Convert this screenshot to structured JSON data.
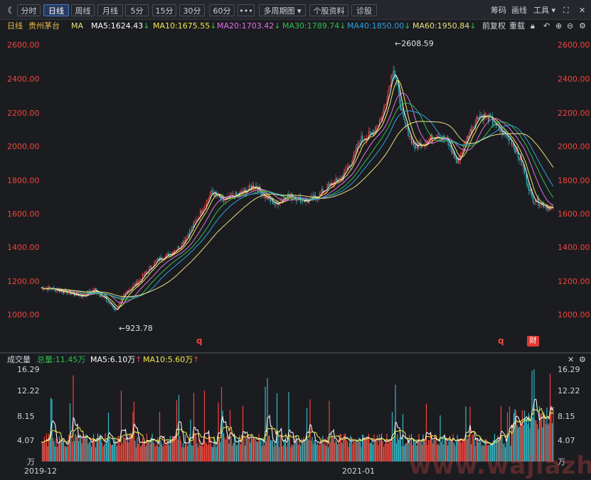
{
  "toolbar": {
    "back_label": "《",
    "tabs": [
      "分时",
      "日线",
      "周线",
      "月线",
      "5分",
      "15分",
      "30分",
      "60分",
      "•••",
      "多周期图 ▾",
      "个股资料",
      "诊股"
    ],
    "active_tab": "日线",
    "right": [
      "筹码",
      "画线",
      "工具 ▾"
    ]
  },
  "info": {
    "period": "日线",
    "stock_name": "贵州茅台",
    "ma_label": "MA",
    "ma5": "MA5:1624.43",
    "ma10": "MA10:1675.55",
    "ma20": "MA20:1703.42",
    "ma30": "MA30:1789.74",
    "ma40": "MA40:1850.00",
    "ma60": "MA60:1950.84",
    "down_arrow": "↓",
    "fuquan": "前复权",
    "reload": "重载"
  },
  "colors": {
    "ma5": "#ffffff",
    "ma10": "#f2e94a",
    "ma20": "#e070e8",
    "ma30": "#2fbf4f",
    "ma40": "#2fa0e0",
    "ma60": "#e8e07a",
    "up": "#f0443a",
    "down": "#31b8c6"
  },
  "price_axis": [
    "2600.00",
    "2400.00",
    "2200.00",
    "2000.00",
    "1800.00",
    "1600.00",
    "1400.00",
    "1200.00",
    "1000.00"
  ],
  "annotations": {
    "high": "2608.59",
    "low": "923.78",
    "high_arrow": "←",
    "low_arrow": "←"
  },
  "q_marks": [
    "q",
    "q"
  ],
  "cai_badge": "财",
  "volume": {
    "title": "成交量",
    "total": "总量:11.45万",
    "ma5": "MA5:6.10万",
    "ma10": "MA10:5.60万",
    "up_arrow": "↑",
    "axis": [
      "16.29",
      "12.22",
      "8.15",
      "4.07",
      "万"
    ]
  },
  "dates": [
    "2019-12",
    "2021-01"
  ],
  "watermark": "www.wajiazhi.com",
  "chart_data": {
    "type": "candlestick",
    "title": "贵州茅台 日线",
    "ylim": [
      900,
      2650
    ],
    "max_label": 2608.59,
    "min_label": 923.78,
    "close_path_approx": [
      [
        0,
        1120
      ],
      [
        10,
        1115
      ],
      [
        20,
        1100
      ],
      [
        30,
        1080
      ],
      [
        40,
        1070
      ],
      [
        50,
        1110
      ],
      [
        60,
        1050
      ],
      [
        70,
        980
      ],
      [
        80,
        1100
      ],
      [
        90,
        1150
      ],
      [
        100,
        1230
      ],
      [
        110,
        1300
      ],
      [
        120,
        1330
      ],
      [
        130,
        1380
      ],
      [
        140,
        1480
      ],
      [
        150,
        1600
      ],
      [
        160,
        1720
      ],
      [
        170,
        1660
      ],
      [
        180,
        1690
      ],
      [
        190,
        1720
      ],
      [
        200,
        1760
      ],
      [
        210,
        1690
      ],
      [
        220,
        1640
      ],
      [
        230,
        1700
      ],
      [
        240,
        1680
      ],
      [
        250,
        1660
      ],
      [
        260,
        1700
      ],
      [
        270,
        1760
      ],
      [
        280,
        1800
      ],
      [
        290,
        1900
      ],
      [
        300,
        2050
      ],
      [
        310,
        2080
      ],
      [
        320,
        2200
      ],
      [
        330,
        2500
      ],
      [
        340,
        2150
      ],
      [
        350,
        2000
      ],
      [
        360,
        2030
      ],
      [
        370,
        2080
      ],
      [
        380,
        2040
      ],
      [
        390,
        1900
      ],
      [
        400,
        2070
      ],
      [
        410,
        2200
      ],
      [
        420,
        2180
      ],
      [
        430,
        2100
      ],
      [
        440,
        2050
      ],
      [
        450,
        1900
      ],
      [
        460,
        1680
      ],
      [
        470,
        1640
      ],
      [
        480,
        1610
      ]
    ],
    "volume_ylim": [
      0,
      16.29
    ]
  }
}
